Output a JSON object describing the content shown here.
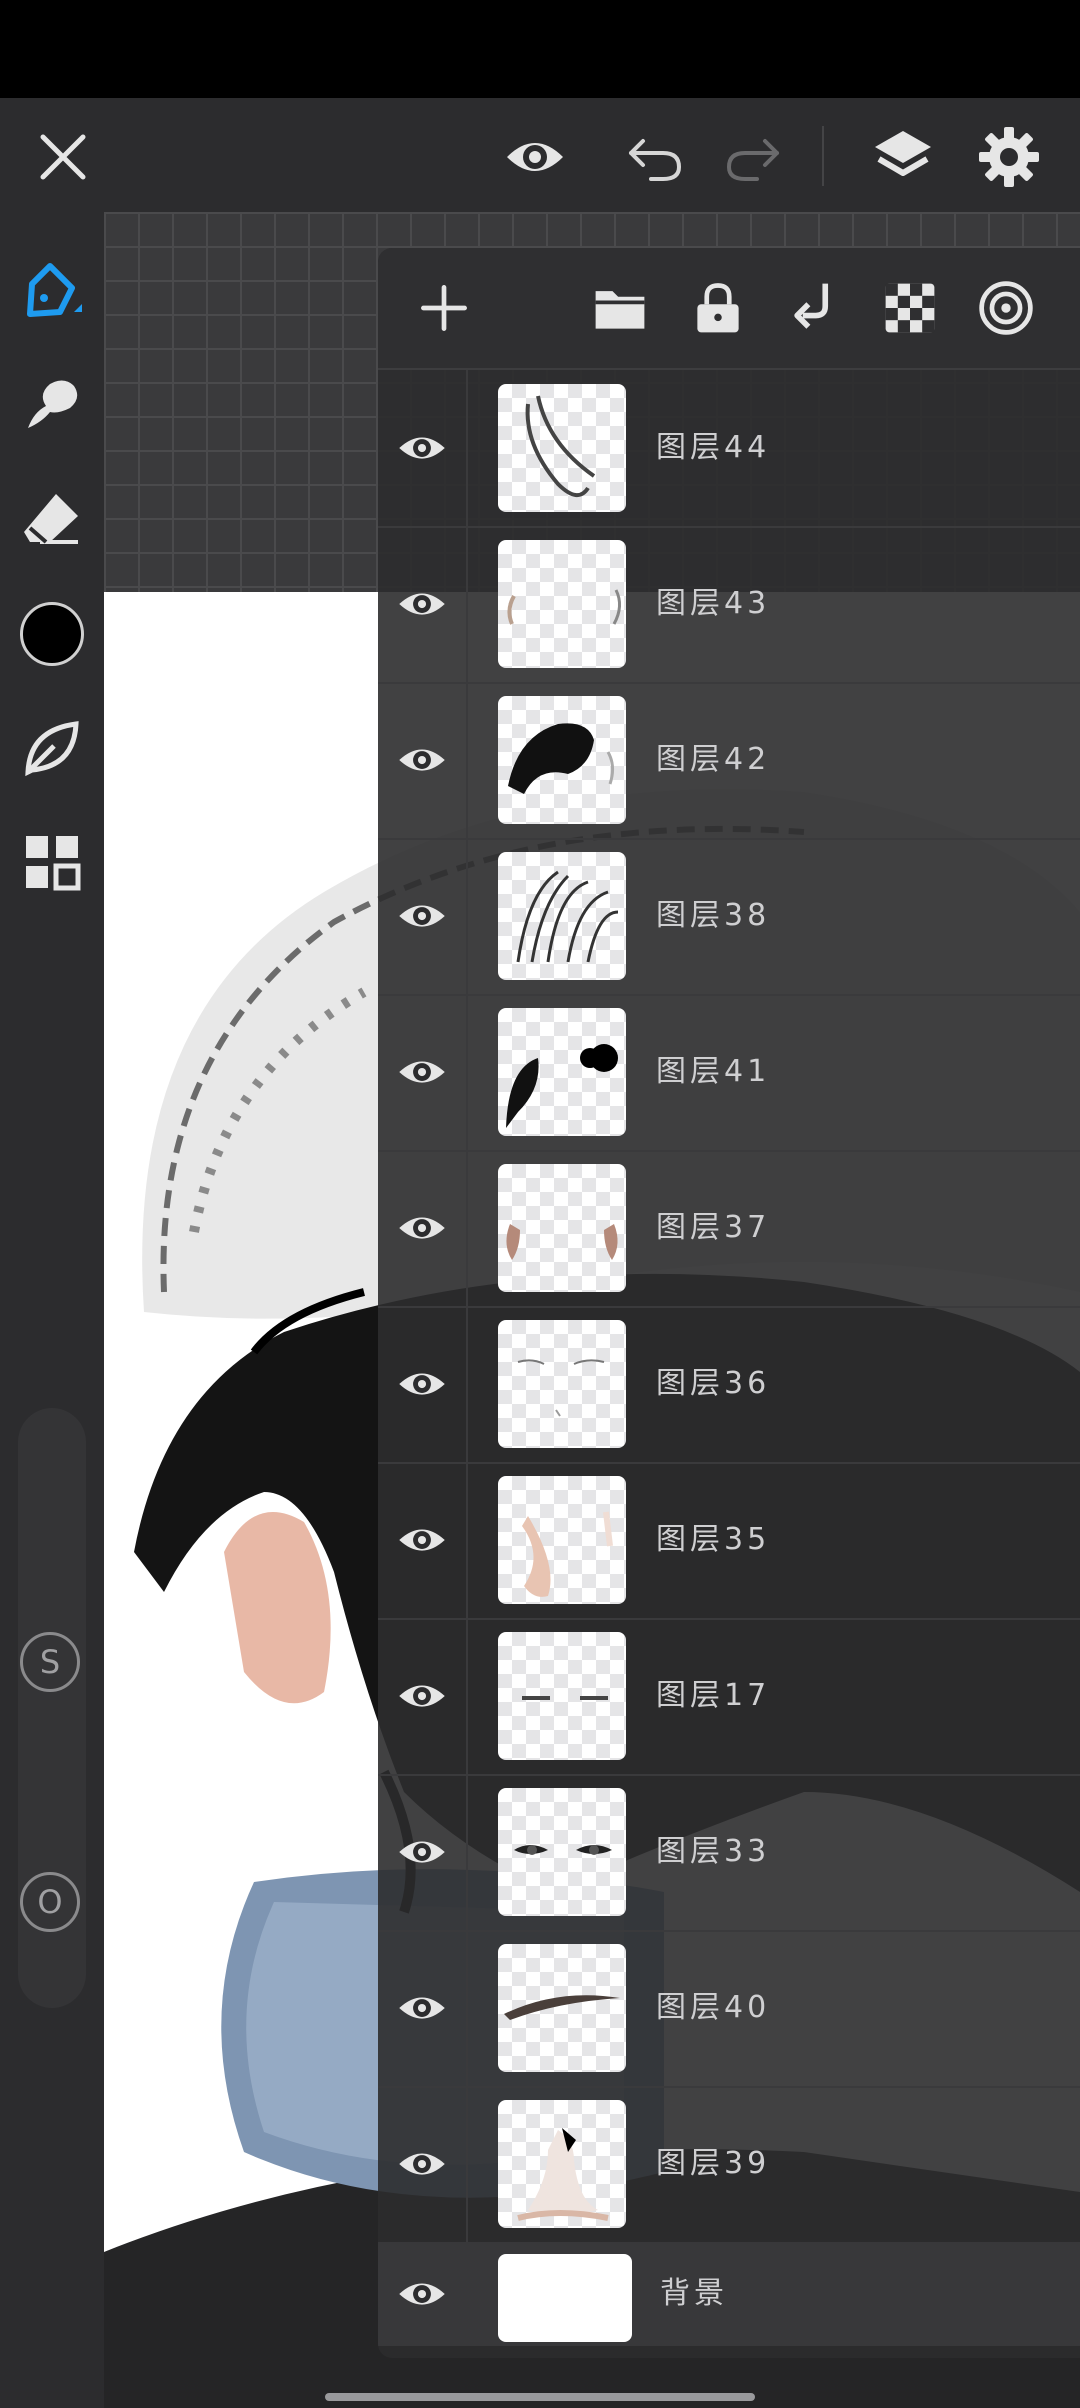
{
  "app": {
    "accent_color": "#1e9bf0",
    "current_color": "#000000"
  },
  "toolbar": {
    "icons": [
      "close-icon",
      "eye-icon",
      "undo-icon",
      "redo-icon",
      "layers-icon",
      "gear-icon"
    ]
  },
  "tools": [
    "pen-icon",
    "smudge-icon",
    "eraser-icon",
    "color-swatch",
    "leaf-icon",
    "grid-icon"
  ],
  "sliders": {
    "size_badge": "S",
    "opacity_badge": "O"
  },
  "layers_panel": {
    "toolbar_icons": [
      "add-icon",
      "folder-icon",
      "lock-icon",
      "merge-down-icon",
      "transparency-icon",
      "target-icon"
    ],
    "layers": [
      {
        "name": "图层44",
        "visible": true
      },
      {
        "name": "图层43",
        "visible": true
      },
      {
        "name": "图层42",
        "visible": true
      },
      {
        "name": "图层38",
        "visible": true
      },
      {
        "name": "图层41",
        "visible": true
      },
      {
        "name": "图层37",
        "visible": true
      },
      {
        "name": "图层36",
        "visible": true
      },
      {
        "name": "图层35",
        "visible": true
      },
      {
        "name": "图层17",
        "visible": true
      },
      {
        "name": "图层33",
        "visible": true
      },
      {
        "name": "图层40",
        "visible": true
      },
      {
        "name": "图层39",
        "visible": true
      },
      {
        "name": "背景",
        "visible": true
      }
    ]
  }
}
